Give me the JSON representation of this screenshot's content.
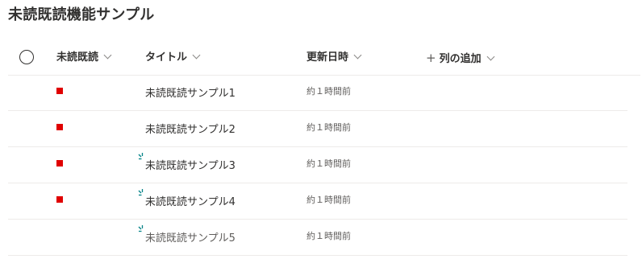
{
  "page": {
    "title": "未読既読機能サンプル"
  },
  "columns": {
    "unread": "未読既読",
    "title": "タイトル",
    "modified": "更新日時",
    "add_column": "列の追加",
    "add_symbol": "+"
  },
  "rows": [
    {
      "title": "未読既読サンプル1",
      "modified": "約１時間前",
      "unread": true,
      "new_badge": false
    },
    {
      "title": "未読既読サンプル2",
      "modified": "約１時間前",
      "unread": true,
      "new_badge": false
    },
    {
      "title": "未読既読サンプル3",
      "modified": "約１時間前",
      "unread": true,
      "new_badge": true
    },
    {
      "title": "未読既読サンプル4",
      "modified": "約１時間前",
      "unread": true,
      "new_badge": true
    },
    {
      "title": "未読既読サンプル5",
      "modified": "約１時間前",
      "unread": false,
      "new_badge": true
    }
  ],
  "colors": {
    "unread_mark": "#e00000",
    "new_badge": "#038387"
  },
  "icons": {
    "new_badge": "new-item-glimmer-icon",
    "select": "circle-select-icon",
    "sort": "chevron-down-icon"
  }
}
